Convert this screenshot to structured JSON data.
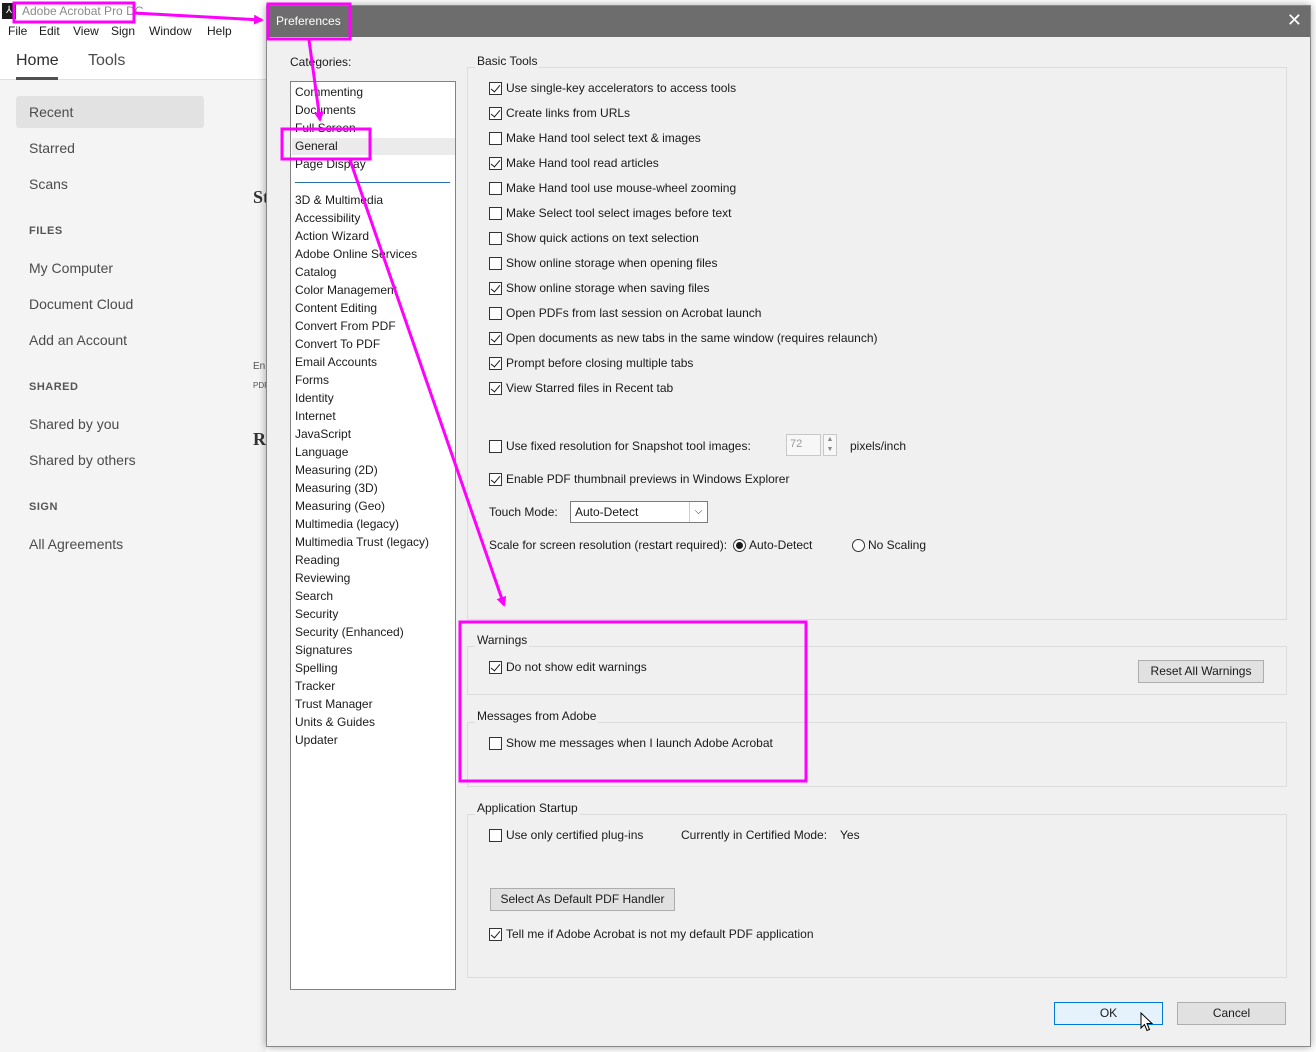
{
  "app": {
    "title": "Adobe Acrobat Pro DC",
    "menu": [
      "File",
      "Edit",
      "View",
      "Sign",
      "Window",
      "Help"
    ],
    "tabs": {
      "home": "Home",
      "tools": "Tools"
    },
    "nav": {
      "recent": "Recent",
      "starred": "Starred",
      "scans": "Scans",
      "files_heading": "FILES",
      "my_computer": "My Computer",
      "document_cloud": "Document Cloud",
      "add_account": "Add an Account",
      "shared_heading": "SHARED",
      "shared_by_you": "Shared by you",
      "shared_by_others": "Shared by others",
      "sign_heading": "SIGN",
      "all_agreements": "All Agreements"
    },
    "fragments": {
      "s": "St",
      "en": "En",
      "pdf": "PDF",
      "r": "Re"
    }
  },
  "dialog": {
    "title": "Preferences",
    "close_glyph": "✕",
    "categories_label": "Categories:",
    "categories_top": [
      "Commenting",
      "Documents",
      "Full Screen",
      "General",
      "Page Display"
    ],
    "selected_category": "General",
    "categories": [
      "3D & Multimedia",
      "Accessibility",
      "Action Wizard",
      "Adobe Online Services",
      "Catalog",
      "Color Management",
      "Content Editing",
      "Convert From PDF",
      "Convert To PDF",
      "Email Accounts",
      "Forms",
      "Identity",
      "Internet",
      "JavaScript",
      "Language",
      "Measuring (2D)",
      "Measuring (3D)",
      "Measuring (Geo)",
      "Multimedia (legacy)",
      "Multimedia Trust (legacy)",
      "Reading",
      "Reviewing",
      "Search",
      "Security",
      "Security (Enhanced)",
      "Signatures",
      "Spelling",
      "Tracker",
      "Trust Manager",
      "Units & Guides",
      "Updater"
    ],
    "basic_tools": {
      "title": "Basic Tools",
      "options": [
        {
          "label": "Use single-key accelerators to access tools",
          "checked": true
        },
        {
          "label": "Create links from URLs",
          "checked": true
        },
        {
          "label": "Make Hand tool select text & images",
          "checked": false
        },
        {
          "label": "Make Hand tool read articles",
          "checked": true
        },
        {
          "label": "Make Hand tool use mouse-wheel zooming",
          "checked": false
        },
        {
          "label": "Make Select tool select images before text",
          "checked": false
        },
        {
          "label": "Show quick actions on text selection",
          "checked": false
        },
        {
          "label": "Show online storage when opening files",
          "checked": false
        },
        {
          "label": "Show online storage when saving files",
          "checked": true
        },
        {
          "label": "Open PDFs from last session on Acrobat launch",
          "checked": false
        },
        {
          "label": "Open documents as new tabs in the same window (requires relaunch)",
          "checked": true
        },
        {
          "label": "Prompt before closing multiple tabs",
          "checked": true
        },
        {
          "label": "View Starred files in Recent tab",
          "checked": true
        }
      ],
      "snapshot": {
        "label": "Use fixed resolution for Snapshot tool images:",
        "checked": false,
        "value": "72",
        "unit": "pixels/inch"
      },
      "thumbnail": {
        "label": "Enable PDF thumbnail previews in Windows Explorer",
        "checked": true
      },
      "touch_mode": {
        "label": "Touch Mode:",
        "value": "Auto-Detect"
      },
      "scale": {
        "label": "Scale for screen resolution (restart required):",
        "option_auto": "Auto-Detect",
        "option_none": "No Scaling",
        "selected": "Auto-Detect"
      }
    },
    "warnings": {
      "title": "Warnings",
      "option": {
        "label": "Do not show edit warnings",
        "checked": true
      },
      "reset_button": "Reset All Warnings"
    },
    "messages": {
      "title": "Messages from Adobe",
      "option": {
        "label": "Show me messages when I launch Adobe Acrobat",
        "checked": false
      }
    },
    "startup": {
      "title": "Application Startup",
      "certified": {
        "label": "Use only certified plug-ins",
        "checked": false
      },
      "certified_mode_label": "Currently in Certified Mode:",
      "certified_mode_value": "Yes",
      "default_handler_button": "Select As Default PDF Handler",
      "tell_me": {
        "label": "Tell me if Adobe Acrobat is not my default PDF application",
        "checked": true
      }
    },
    "ok_button": "OK",
    "cancel_button": "Cancel"
  },
  "colors": {
    "annotation": "#ff00ff",
    "titlebar": "#6d6d6d",
    "dialog_bg": "#f0f0f0"
  }
}
